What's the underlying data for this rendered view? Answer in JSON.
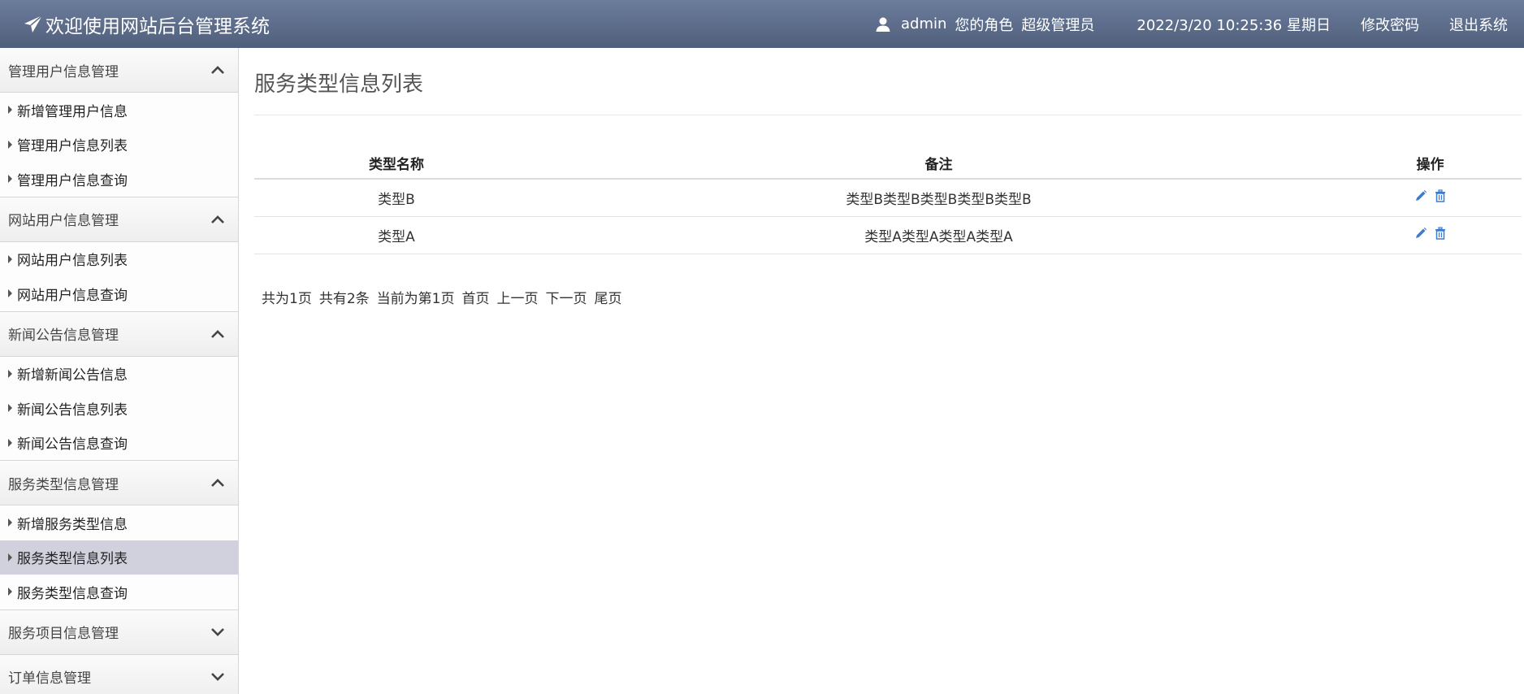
{
  "header": {
    "title": "欢迎使用网站后台管理系统",
    "username": "admin",
    "role_label": "您的角色",
    "role_value": "超级管理员",
    "datetime": "2022/3/20 10:25:36 星期日",
    "change_password": "修改密码",
    "logout": "退出系统"
  },
  "sidebar": {
    "groups": [
      {
        "title": "管理用户信息管理",
        "expanded": true,
        "items": [
          "新增管理用户信息",
          "管理用户信息列表",
          "管理用户信息查询"
        ]
      },
      {
        "title": "网站用户信息管理",
        "expanded": true,
        "items": [
          "网站用户信息列表",
          "网站用户信息查询"
        ]
      },
      {
        "title": "新闻公告信息管理",
        "expanded": true,
        "items": [
          "新增新闻公告信息",
          "新闻公告信息列表",
          "新闻公告信息查询"
        ]
      },
      {
        "title": "服务类型信息管理",
        "expanded": true,
        "items": [
          "新增服务类型信息",
          "服务类型信息列表",
          "服务类型信息查询"
        ]
      },
      {
        "title": "服务项目信息管理",
        "expanded": false,
        "items": []
      },
      {
        "title": "订单信息管理",
        "expanded": false,
        "items": []
      }
    ],
    "active_item": "服务类型信息列表"
  },
  "main": {
    "title": "服务类型信息列表",
    "table": {
      "headers": [
        "类型名称",
        "备注",
        "操作"
      ],
      "rows": [
        {
          "name": "类型B",
          "note": "类型B类型B类型B类型B类型B"
        },
        {
          "name": "类型A",
          "note": "类型A类型A类型A类型A"
        }
      ]
    },
    "pager": {
      "total_pages": "共为1页",
      "total_items": "共有2条",
      "current": "当前为第1页",
      "first": "首页",
      "prev": "上一页",
      "next": "下一页",
      "last": "尾页"
    }
  },
  "colors": {
    "header_top": "#6c7d9c",
    "header_bottom": "#4f5f7b",
    "active_item_bg": "#d0d1dc",
    "icon_blue": "#3a7bd5"
  },
  "icons": {
    "brand": "paper-plane-icon",
    "user": "user-icon",
    "expanded": "chevron-up-icon",
    "collapsed": "chevron-down-icon",
    "edit": "pencil-icon",
    "delete": "trash-icon"
  }
}
